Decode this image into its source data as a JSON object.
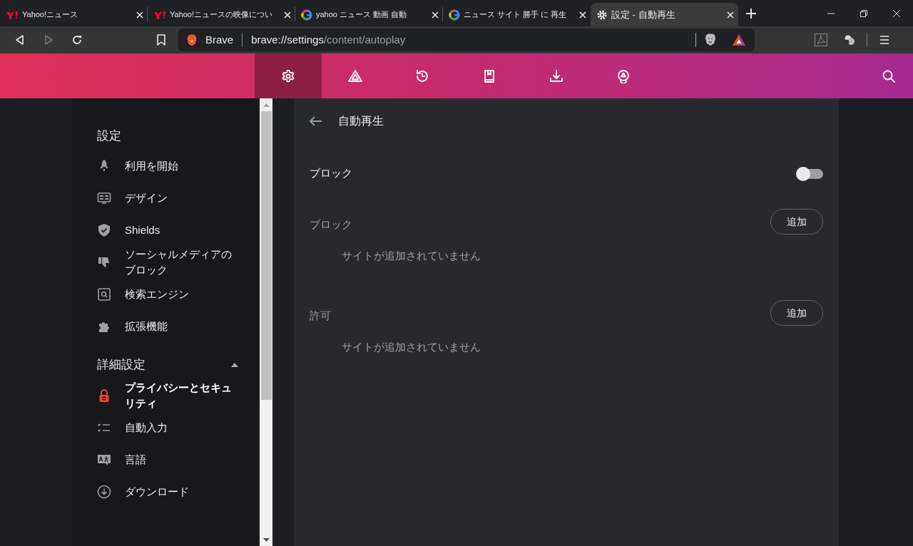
{
  "tabs": [
    {
      "title": "Yahoo!ニュース",
      "selected": false
    },
    {
      "title": "Yahoo!ニュースの映像につい",
      "selected": false
    },
    {
      "title": "yahoo ニュース 動画 自動",
      "selected": false
    },
    {
      "title": "ニュース サイト 勝手 に 再生",
      "selected": false
    },
    {
      "title": "設定 - 自動再生",
      "selected": true
    }
  ],
  "address_bar": {
    "site_label": "Brave",
    "url_host": "brave://settings",
    "url_path": "/content/autoplay"
  },
  "nav": [
    {
      "selected": true
    },
    {
      "selected": false
    },
    {
      "selected": false
    },
    {
      "selected": false
    },
    {
      "selected": false
    },
    {
      "selected": false
    }
  ],
  "sidebar": {
    "items": [
      {
        "kind": "heading",
        "label": "設定"
      },
      {
        "kind": "item",
        "label": "利用を開始",
        "selected": false
      },
      {
        "kind": "item",
        "label": "デザイン",
        "selected": false
      },
      {
        "kind": "item",
        "label": "Shields",
        "selected": false
      },
      {
        "kind": "item",
        "label": "ソーシャルメディアのブロック",
        "selected": false
      },
      {
        "kind": "item",
        "label": "検索エンジン",
        "selected": false
      },
      {
        "kind": "item",
        "label": "拡張機能",
        "selected": false
      },
      {
        "kind": "section",
        "label": "詳細設定",
        "expanded": true
      },
      {
        "kind": "item",
        "label": "プライバシーとセキュリティ",
        "selected": true
      },
      {
        "kind": "item",
        "label": "自動入力",
        "selected": false
      },
      {
        "kind": "item",
        "label": "言語",
        "selected": false
      },
      {
        "kind": "item",
        "label": "ダウンロード",
        "selected": false
      }
    ]
  },
  "page": {
    "title": "自動再生",
    "toggle": {
      "label": "ブロック",
      "on": false
    },
    "lists": [
      {
        "heading": "ブロック",
        "button": "追加",
        "empty": "サイトが追加されていません"
      },
      {
        "heading": "許可",
        "button": "追加",
        "empty": "サイトが追加されていません"
      }
    ]
  }
}
